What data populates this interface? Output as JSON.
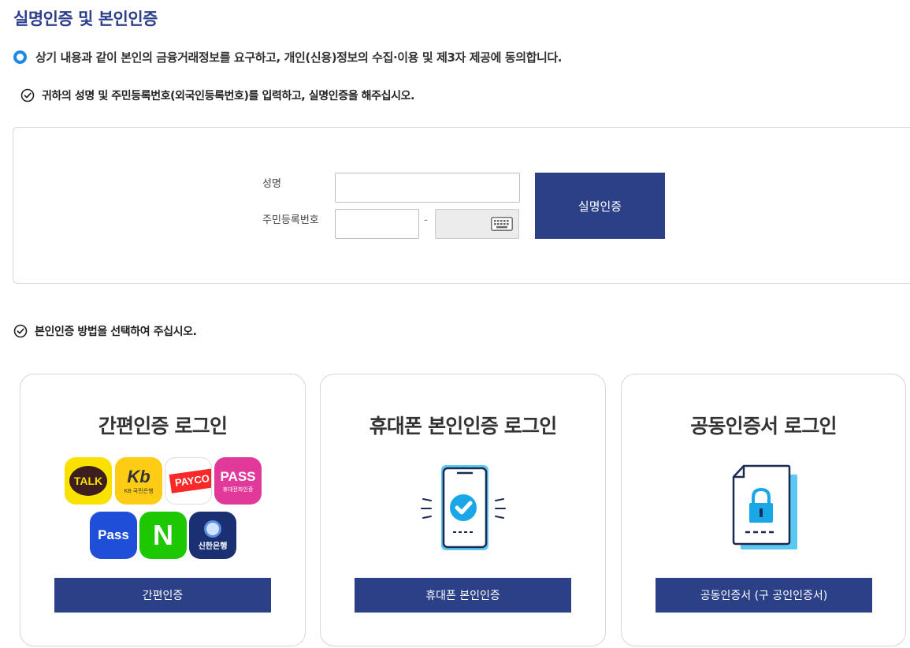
{
  "page_title": "실명인증 및 본인인증",
  "consent_text": "상기 내용과 같이 본인의 금융거래정보를 요구하고, 개인(신용)정보의 수집·이용 및 제3자 제공에 동의합니다.",
  "guide_text": "귀하의 성명 및 주민등록번호(외국인등록번호)를 입력하고, 실명인증을 해주십시오.",
  "name_form": {
    "name_label": "성명",
    "rrn_label": "주민등록번호",
    "name_value": "",
    "rrn_front_value": "",
    "dash": "-",
    "verify_button": "실명인증"
  },
  "method_text": "본인인증 방법을 선택하여 주십시오.",
  "cards": {
    "simple": {
      "title": "간편인증 로그인",
      "button": "간편인증",
      "apps": {
        "kakao": "TALK",
        "kb_top": "Kb",
        "kb_bottom": "KB 국민은행",
        "payco": "PAYCO",
        "pass_top": "PASS",
        "pass_bottom": "휴대전화인증",
        "pass2": "Pass",
        "naver": "N",
        "shinhan": "신한은행"
      }
    },
    "phone": {
      "title": "휴대폰 본인인증 로그인",
      "button": "휴대폰 본인인증"
    },
    "cert": {
      "title": "공동인증서 로그인",
      "button": "공동인증서 (구 공인인증서)"
    }
  },
  "colors": {
    "brand_navy": "#2c4088",
    "title_blue": "#2c3e8c",
    "radio_blue": "#1e88e5",
    "illus_cyan": "#5bc8f2",
    "illus_navy": "#1b2a52"
  }
}
